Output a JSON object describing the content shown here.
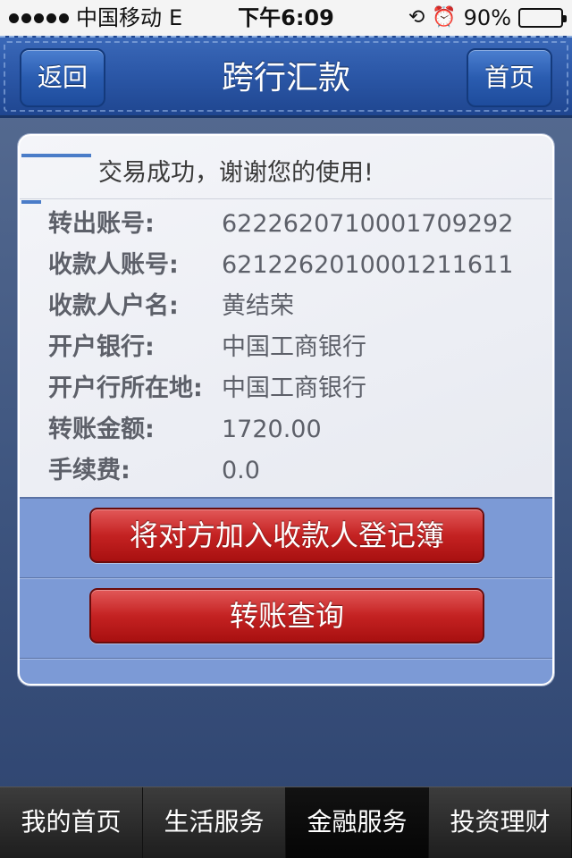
{
  "status_bar": {
    "carrier": "中国移动",
    "network": "E",
    "time": "下午6:09",
    "battery_percent": "90%",
    "battery_level": 0.9,
    "icons": [
      "signal-dots-icon",
      "rotation-lock-icon",
      "alarm-icon",
      "battery-icon"
    ]
  },
  "nav": {
    "title": "跨行汇款",
    "back_label": "返回",
    "home_label": "首页"
  },
  "card": {
    "heading": "交易成功，谢谢您的使用!",
    "fields": [
      {
        "label": "转出账号:",
        "value": "6222620710001709292"
      },
      {
        "label": "收款人账号:",
        "value": "6212262010001211611"
      },
      {
        "label": "收款人户名:",
        "value": "黄结荣"
      },
      {
        "label": "开户银行:",
        "value": "中国工商银行"
      },
      {
        "label": "开户行所在地:",
        "value": "中国工商银行"
      },
      {
        "label": "转账金额:",
        "value": "1720.00"
      },
      {
        "label": "手续费:",
        "value": "0.0"
      }
    ],
    "actions": [
      {
        "label": "将对方加入收款人登记簿"
      },
      {
        "label": "转账查询"
      }
    ]
  },
  "tabs": [
    {
      "label": "我的首页"
    },
    {
      "label": "生活服务"
    },
    {
      "label": "金融服务",
      "active": true
    },
    {
      "label": "投资理财"
    }
  ],
  "colors": {
    "nav_blue": "#2c58a8",
    "action_red": "#c42222",
    "action_area_blue": "#7c9ad6"
  }
}
